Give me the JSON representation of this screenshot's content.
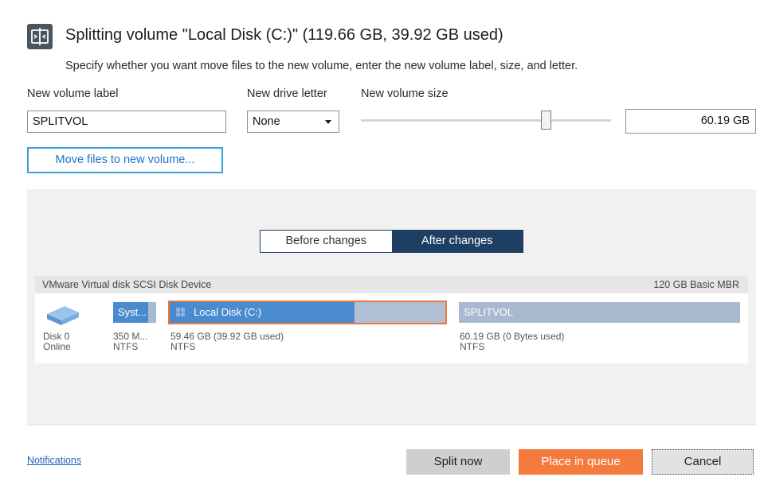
{
  "dialog": {
    "title": "Splitting volume \"Local Disk (C:)\" (119.66 GB, 39.92 GB used)",
    "subtitle": "Specify whether you want move files to the new volume, enter the new volume label, size, and letter.",
    "icon": "split-volume-icon"
  },
  "form": {
    "volume_label_caption": "New volume label",
    "volume_label_value": "SPLITVOL",
    "drive_letter_caption": "New drive letter",
    "drive_letter_value": "None",
    "volume_size_caption": "New volume size",
    "volume_size_value": "60.19 GB",
    "slider_fraction": 0.73,
    "move_files_label": "Move files to new volume..."
  },
  "view_toggle": {
    "before_label": "Before changes",
    "after_label": "After changes",
    "active": "after"
  },
  "disk": {
    "name": "VMware Virtual disk SCSI Disk Device",
    "meta": "120 GB Basic MBR",
    "id": "Disk 0",
    "status": "Online",
    "partitions": [
      {
        "name": "Syst...",
        "size": "350 M...",
        "fs": "NTFS",
        "used_fraction": 0.8
      },
      {
        "name": "Local Disk (C:)",
        "size": "59.46 GB (39.92 GB used)",
        "fs": "NTFS",
        "used_fraction": 0.67,
        "selected": true
      },
      {
        "name": "SPLITVOL",
        "size": "60.19 GB (0 Bytes used)",
        "fs": "NTFS",
        "used_fraction": 0
      }
    ]
  },
  "footer": {
    "notifications_link": "Notifications",
    "split_now_label": "Split now",
    "place_in_queue_label": "Place in queue",
    "cancel_label": "Cancel"
  },
  "colors": {
    "accent_orange": "#f47a3e",
    "toggle_active": "#1c3f63",
    "partition_used": "#4a8bd0",
    "partition_free": "#a9b9cf",
    "link_blue": "#1f74c7"
  }
}
